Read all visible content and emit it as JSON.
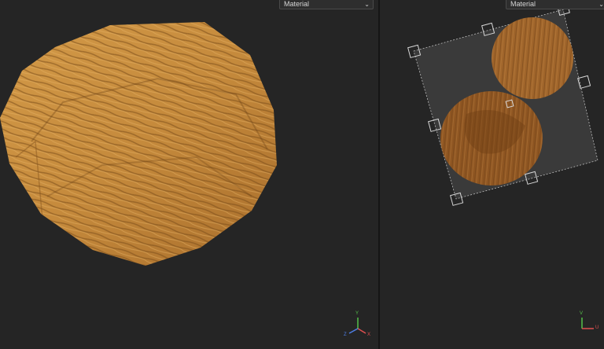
{
  "left_viewport": {
    "shading_mode": "Material",
    "dropdown_icon": "chevron-down-icon"
  },
  "right_viewport": {
    "shading_mode": "Material",
    "dropdown_icon": "chevron-down-icon"
  },
  "axis_gizmo_3d": {
    "y": "Y",
    "x": "X",
    "z": "Z"
  },
  "axis_gizmo_uv": {
    "v": "V",
    "u": "U"
  },
  "colors": {
    "background": "#252525",
    "wood_light": "#c9913f",
    "wood_dark": "#8a5a22",
    "axis_y": "#55c04a",
    "axis_x": "#e05050",
    "axis_z": "#4f7ee6"
  }
}
